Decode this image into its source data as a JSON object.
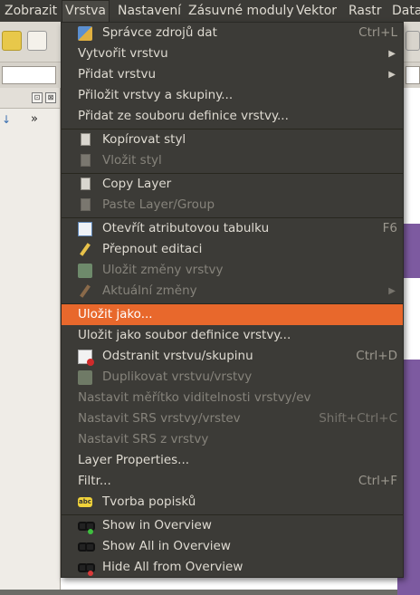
{
  "menubar": {
    "items": [
      "Zobrazit",
      "Vrstva",
      "Nastavení",
      "Zásuvné moduly",
      "Vektor",
      "Rastr",
      "Data"
    ],
    "active": "Vrstva"
  },
  "panel": {
    "float_btn": "⊡",
    "close_btn": "⊠",
    "more": "»"
  },
  "menu": {
    "items": [
      {
        "label": "Správce zdrojů dat",
        "shortcut": "Ctrl+L"
      },
      {
        "label": "Vytvořit vrstvu",
        "shortcut": ""
      },
      {
        "label": "Přidat vrstvu",
        "shortcut": ""
      },
      {
        "label": "Přiložit vrstvy a skupiny...",
        "shortcut": ""
      },
      {
        "label": "Přidat ze souboru definice vrstvy...",
        "shortcut": ""
      },
      {
        "label": "Kopírovat styl",
        "shortcut": ""
      },
      {
        "label": "Vložit styl",
        "shortcut": ""
      },
      {
        "label": "Copy Layer",
        "shortcut": ""
      },
      {
        "label": "Paste Layer/Group",
        "shortcut": ""
      },
      {
        "label": "Otevřít atributovou tabulku",
        "shortcut": "F6"
      },
      {
        "label": "Přepnout editaci",
        "shortcut": ""
      },
      {
        "label": "Uložit změny vrstvy",
        "shortcut": ""
      },
      {
        "label": "Aktuální změny",
        "shortcut": ""
      },
      {
        "label": "Uložit jako...",
        "shortcut": ""
      },
      {
        "label": "Uložit jako soubor definice vrstvy...",
        "shortcut": ""
      },
      {
        "label": "Odstranit vrstvu/skupinu",
        "shortcut": "Ctrl+D"
      },
      {
        "label": "Duplikovat vrstvu/vrstvy",
        "shortcut": ""
      },
      {
        "label": "Nastavit měřítko viditelnosti vrstvy/ev",
        "shortcut": ""
      },
      {
        "label": "Nastavit SRS vrstvy/vrstev",
        "shortcut": "Shift+Ctrl+C"
      },
      {
        "label": "Nastavit SRS z vrstvy",
        "shortcut": ""
      },
      {
        "label": "Layer Properties...",
        "shortcut": ""
      },
      {
        "label": "Filtr...",
        "shortcut": "Ctrl+F"
      },
      {
        "label": "Tvorba popisků",
        "shortcut": ""
      },
      {
        "label": "Show in Overview",
        "shortcut": ""
      },
      {
        "label": "Show All in Overview",
        "shortcut": ""
      },
      {
        "label": "Hide All from Overview",
        "shortcut": ""
      }
    ]
  },
  "icons": {
    "data_source": "data-source-manager-icon",
    "copy_style": "copy-icon",
    "attr_table": "table-icon",
    "toggle_edit": "pencil-icon",
    "labeling": "abc-label-icon",
    "overview": "glasses-icon"
  },
  "colors": {
    "menu_bg": "#3c3b37",
    "highlight": "#e8682c",
    "text": "#dfdbd2",
    "disabled_text": "#86837b"
  }
}
